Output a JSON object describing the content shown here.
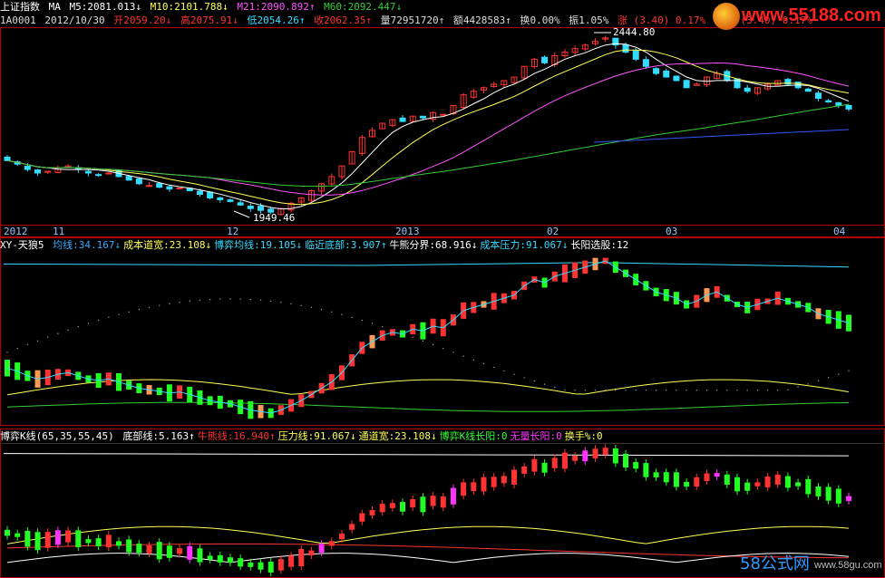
{
  "panel1": {
    "row1": {
      "name": "上证指数",
      "ma": "MA",
      "m5": "M5:2081.013",
      "m5_arrow": "↓",
      "m10": "M10:2101.788",
      "m10_arrow": "↓",
      "m21": "M21:2090.892",
      "m21_arrow": "↑",
      "m60": "M60:2092.447",
      "m60_arrow": "↓"
    },
    "row2": {
      "code": "1A0001",
      "date": "2012/10/30",
      "open": "开2059.20",
      "open_arrow": "↓",
      "high": "高2075.91",
      "high_arrow": "↓",
      "low": "低2054.26",
      "low_arrow": "↑",
      "close": "收2062.35",
      "close_arrow": "↑",
      "vol": "量72951720",
      "vol_arrow": "↑",
      "amount": "额4428583",
      "amount_arrow": "↑",
      "turnover": "换0.00%",
      "amplitude": "振1.05%",
      "change": "涨 (3.40) 0.17%",
      "index": "指数 (3.40) 0.17%"
    }
  },
  "logo": {
    "site": "www.55188.com"
  },
  "chart_labels": {
    "high_label": "2444.80",
    "low_label": "1949.46"
  },
  "date_axis": [
    "2012",
    "11",
    "12",
    "2013",
    "02",
    "03",
    "04"
  ],
  "panel2": {
    "prefix": "XY-天狼5",
    "items": [
      {
        "text": "均线:34.167",
        "arrow": "↓",
        "color": "#33aaff"
      },
      {
        "text": "成本道宽:23.108",
        "arrow": "↓",
        "color": "#ffff55"
      },
      {
        "text": "博弈均线:19.105",
        "arrow": "↓",
        "color": "#33ddff"
      },
      {
        "text": "临近底部:3.907",
        "arrow": "↑",
        "color": "#33ddff"
      },
      {
        "text": "牛熊分界:68.916",
        "arrow": "↓",
        "color": "#ffffff"
      },
      {
        "text": "成本压力:91.067",
        "arrow": "↓",
        "color": "#33ddff"
      },
      {
        "text": "长阳选股:12",
        "arrow": "",
        "color": "#ffffff"
      }
    ]
  },
  "panel3": {
    "prefix": "博弈K线(65,35,55,45)",
    "items": [
      {
        "text": "底部线:5.163",
        "arrow": "↑",
        "color": "#ffffff"
      },
      {
        "text": "牛熊线:16.940",
        "arrow": "↑",
        "color": "#ff3333"
      },
      {
        "text": "压力线:91.067",
        "arrow": "↓",
        "color": "#ffff55"
      },
      {
        "text": "通道宽:23.108",
        "arrow": "↓",
        "color": "#ffff55"
      },
      {
        "text": "博弈K线长阳:0",
        "arrow": "",
        "color": "#33ff33"
      },
      {
        "text": "无量长阳:0",
        "arrow": "",
        "color": "#ff33ff"
      },
      {
        "text": "换手%:0",
        "arrow": "",
        "color": "#ffff55"
      }
    ]
  },
  "watermark": {
    "a": "58公式网",
    "b": "www.58gu.com"
  },
  "colors": {
    "up": "#ff3333",
    "down": "#33ddff",
    "green_down": "#22ff22",
    "orange": "#ff9955",
    "magenta": "#ff33ff",
    "ma5": "#ffffff",
    "ma10": "#ffff55",
    "ma21": "#ff55ff",
    "ma60": "#33cc33",
    "ma_long": "#3355ff",
    "grid": "#b00000"
  },
  "chart_data": {
    "type": "candlestick",
    "series_main": {
      "name": "上证指数",
      "closes": [
        2095,
        2085,
        2070,
        2060,
        2065,
        2075,
        2080,
        2070,
        2060,
        2055,
        2060,
        2050,
        2040,
        2030,
        2025,
        2020,
        2015,
        2018,
        2010,
        2000,
        1990,
        1985,
        1980,
        1970,
        1960,
        1955,
        1950,
        1960,
        1975,
        1990,
        2010,
        2030,
        2050,
        2080,
        2120,
        2160,
        2180,
        2200,
        2210,
        2205,
        2220,
        2215,
        2230,
        2225,
        2250,
        2280,
        2290,
        2300,
        2310,
        2320,
        2330,
        2360,
        2380,
        2370,
        2390,
        2400,
        2410,
        2420,
        2430,
        2440,
        2420,
        2400,
        2380,
        2360,
        2340,
        2330,
        2320,
        2300,
        2310,
        2330,
        2340,
        2320,
        2300,
        2290,
        2300,
        2310,
        2320,
        2310,
        2300,
        2290,
        2270,
        2260,
        2250,
        2240
      ],
      "low_mark": 1949.46,
      "high_mark": 2444.8
    }
  }
}
